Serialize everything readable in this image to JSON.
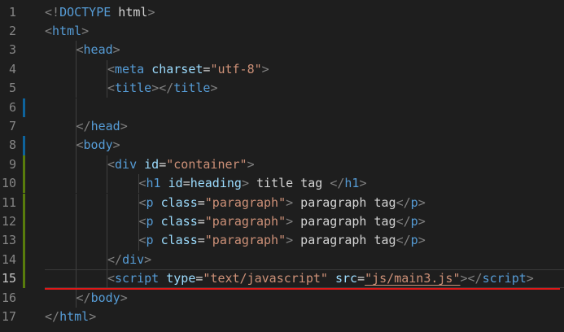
{
  "editor": {
    "active_line": 15,
    "colors": {
      "background": "#1e1e1e",
      "line_number": "#858585",
      "bracket": "#808080",
      "tag": "#569cd6",
      "attribute": "#9cdcfe",
      "string": "#ce9178",
      "text": "#d4d4d4",
      "modified_marker": "#0e639c",
      "added_marker": "#587c0c",
      "error_underline": "#e01818"
    },
    "lines": [
      {
        "n": "1",
        "indent": 0,
        "tokens": [
          {
            "t": "<!",
            "c": "br"
          },
          {
            "t": "DOCTYPE",
            "c": "tag"
          },
          {
            "t": " html",
            "c": "attr2"
          },
          {
            "t": ">",
            "c": "br"
          }
        ]
      },
      {
        "n": "2",
        "indent": 0,
        "tokens": [
          {
            "t": "<",
            "c": "br"
          },
          {
            "t": "html",
            "c": "tag"
          },
          {
            "t": ">",
            "c": "br"
          }
        ]
      },
      {
        "n": "3",
        "indent": 1,
        "tokens": [
          {
            "t": "<",
            "c": "br"
          },
          {
            "t": "head",
            "c": "tag"
          },
          {
            "t": ">",
            "c": "br"
          }
        ]
      },
      {
        "n": "4",
        "indent": 2,
        "tokens": [
          {
            "t": "<",
            "c": "br"
          },
          {
            "t": "meta",
            "c": "tag"
          },
          {
            "t": " ",
            "c": "txt"
          },
          {
            "t": "charset",
            "c": "attr"
          },
          {
            "t": "=",
            "c": "txt"
          },
          {
            "t": "\"utf-8\"",
            "c": "str"
          },
          {
            "t": ">",
            "c": "br"
          }
        ]
      },
      {
        "n": "5",
        "indent": 2,
        "tokens": [
          {
            "t": "<",
            "c": "br"
          },
          {
            "t": "title",
            "c": "tag"
          },
          {
            "t": "></",
            "c": "br"
          },
          {
            "t": "title",
            "c": "tag"
          },
          {
            "t": ">",
            "c": "br"
          }
        ]
      },
      {
        "n": "6",
        "indent": 1,
        "tokens": []
      },
      {
        "n": "7",
        "indent": 1,
        "tokens": [
          {
            "t": "</",
            "c": "br"
          },
          {
            "t": "head",
            "c": "tag"
          },
          {
            "t": ">",
            "c": "br"
          }
        ]
      },
      {
        "n": "8",
        "indent": 1,
        "tokens": [
          {
            "t": "<",
            "c": "br"
          },
          {
            "t": "body",
            "c": "tag"
          },
          {
            "t": ">",
            "c": "br"
          }
        ]
      },
      {
        "n": "9",
        "indent": 2,
        "tokens": [
          {
            "t": "<",
            "c": "br"
          },
          {
            "t": "div",
            "c": "tag"
          },
          {
            "t": " ",
            "c": "txt"
          },
          {
            "t": "id",
            "c": "attr"
          },
          {
            "t": "=",
            "c": "txt"
          },
          {
            "t": "\"container\"",
            "c": "str"
          },
          {
            "t": ">",
            "c": "br"
          }
        ]
      },
      {
        "n": "10",
        "indent": 3,
        "tokens": [
          {
            "t": "<",
            "c": "br"
          },
          {
            "t": "h1",
            "c": "tag"
          },
          {
            "t": " ",
            "c": "txt"
          },
          {
            "t": "id",
            "c": "attr"
          },
          {
            "t": "=",
            "c": "txt"
          },
          {
            "t": "heading",
            "c": "attr"
          },
          {
            "t": ">",
            "c": "br"
          },
          {
            "t": " title tag ",
            "c": "txt"
          },
          {
            "t": "</",
            "c": "br"
          },
          {
            "t": "h1",
            "c": "tag"
          },
          {
            "t": ">",
            "c": "br"
          }
        ]
      },
      {
        "n": "11",
        "indent": 3,
        "tokens": [
          {
            "t": "<",
            "c": "br"
          },
          {
            "t": "p",
            "c": "tag"
          },
          {
            "t": " ",
            "c": "txt"
          },
          {
            "t": "class",
            "c": "attr"
          },
          {
            "t": "=",
            "c": "txt"
          },
          {
            "t": "\"paragraph\"",
            "c": "str"
          },
          {
            "t": ">",
            "c": "br"
          },
          {
            "t": " paragraph tag",
            "c": "txt"
          },
          {
            "t": "</",
            "c": "br"
          },
          {
            "t": "p",
            "c": "tag"
          },
          {
            "t": ">",
            "c": "br"
          }
        ]
      },
      {
        "n": "12",
        "indent": 3,
        "tokens": [
          {
            "t": "<",
            "c": "br"
          },
          {
            "t": "p",
            "c": "tag"
          },
          {
            "t": " ",
            "c": "txt"
          },
          {
            "t": "class",
            "c": "attr"
          },
          {
            "t": "=",
            "c": "txt"
          },
          {
            "t": "\"paragraph\"",
            "c": "str"
          },
          {
            "t": ">",
            "c": "br"
          },
          {
            "t": " paragraph tag",
            "c": "txt"
          },
          {
            "t": "</",
            "c": "br"
          },
          {
            "t": "p",
            "c": "tag"
          },
          {
            "t": ">",
            "c": "br"
          }
        ]
      },
      {
        "n": "13",
        "indent": 3,
        "tokens": [
          {
            "t": "<",
            "c": "br"
          },
          {
            "t": "p",
            "c": "tag"
          },
          {
            "t": " ",
            "c": "txt"
          },
          {
            "t": "class",
            "c": "attr"
          },
          {
            "t": "=",
            "c": "txt"
          },
          {
            "t": "\"paragraph\"",
            "c": "str"
          },
          {
            "t": ">",
            "c": "br"
          },
          {
            "t": " paragraph tag",
            "c": "txt"
          },
          {
            "t": "</",
            "c": "br"
          },
          {
            "t": "p",
            "c": "tag"
          },
          {
            "t": ">",
            "c": "br"
          }
        ]
      },
      {
        "n": "14",
        "indent": 2,
        "tokens": [
          {
            "t": "</",
            "c": "br"
          },
          {
            "t": "div",
            "c": "tag"
          },
          {
            "t": ">",
            "c": "br"
          }
        ]
      },
      {
        "n": "15",
        "indent": 2,
        "tokens": [
          {
            "t": "<",
            "c": "br"
          },
          {
            "t": "script",
            "c": "tag"
          },
          {
            "t": " ",
            "c": "txt"
          },
          {
            "t": "type",
            "c": "attr"
          },
          {
            "t": "=",
            "c": "txt"
          },
          {
            "t": "\"text/javascript\"",
            "c": "str"
          },
          {
            "t": " ",
            "c": "txt"
          },
          {
            "t": "src",
            "c": "attr"
          },
          {
            "t": "=",
            "c": "txt"
          },
          {
            "t": "\"js/main3.js\"",
            "c": "strlink"
          },
          {
            "t": "></",
            "c": "br"
          },
          {
            "t": "script",
            "c": "tag"
          },
          {
            "t": ">",
            "c": "br"
          }
        ]
      },
      {
        "n": "16",
        "indent": 1,
        "tokens": [
          {
            "t": "</",
            "c": "br"
          },
          {
            "t": "body",
            "c": "tag"
          },
          {
            "t": ">",
            "c": "br"
          }
        ]
      },
      {
        "n": "17",
        "indent": 0,
        "tokens": [
          {
            "t": "</",
            "c": "br"
          },
          {
            "t": "html",
            "c": "tag"
          },
          {
            "t": ">",
            "c": "br"
          }
        ]
      }
    ],
    "markers": [
      {
        "line": 6,
        "type": "modified"
      },
      {
        "line": 8,
        "type": "modified"
      },
      {
        "line": 9,
        "type": "added"
      },
      {
        "line": 10,
        "type": "added"
      },
      {
        "line": 11,
        "type": "added"
      },
      {
        "line": 12,
        "type": "added"
      },
      {
        "line": 13,
        "type": "added"
      },
      {
        "line": 14,
        "type": "added"
      },
      {
        "line": 15,
        "type": "added"
      }
    ]
  }
}
